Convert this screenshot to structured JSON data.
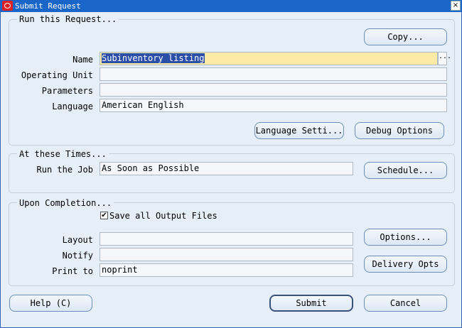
{
  "window": {
    "title": "Submit Request",
    "close_glyph": "×"
  },
  "run_request": {
    "group_title": "Run this Request...",
    "copy_button": "Copy...",
    "name_label": "Name",
    "name_value": "Subinventory listing",
    "lov_glyph": "...",
    "operating_unit_label": "Operating Unit",
    "operating_unit_value": "",
    "parameters_label": "Parameters",
    "parameters_value": "",
    "language_label": "Language",
    "language_value": "American English",
    "language_settings_button": "Language Setti...",
    "debug_options_button": "Debug Options"
  },
  "times": {
    "group_title": "At these Times...",
    "run_job_label": "Run the Job",
    "run_job_value": "As Soon as Possible",
    "schedule_button": "Schedule..."
  },
  "completion": {
    "group_title": "Upon Completion...",
    "save_output_label": "Save all Output Files",
    "save_output_checked": true,
    "check_glyph": "✔",
    "layout_label": "Layout",
    "layout_value": "",
    "options_button": "Options...",
    "notify_label": "Notify",
    "notify_value": "",
    "print_to_label": "Print to",
    "print_to_value": "noprint",
    "delivery_opts_button": "Delivery Opts"
  },
  "footer": {
    "help_button": "Help (C)",
    "submit_button": "Submit",
    "cancel_button": "Cancel"
  },
  "icons": {
    "app_logo": "oracle-logo-icon",
    "close": "close-icon"
  }
}
